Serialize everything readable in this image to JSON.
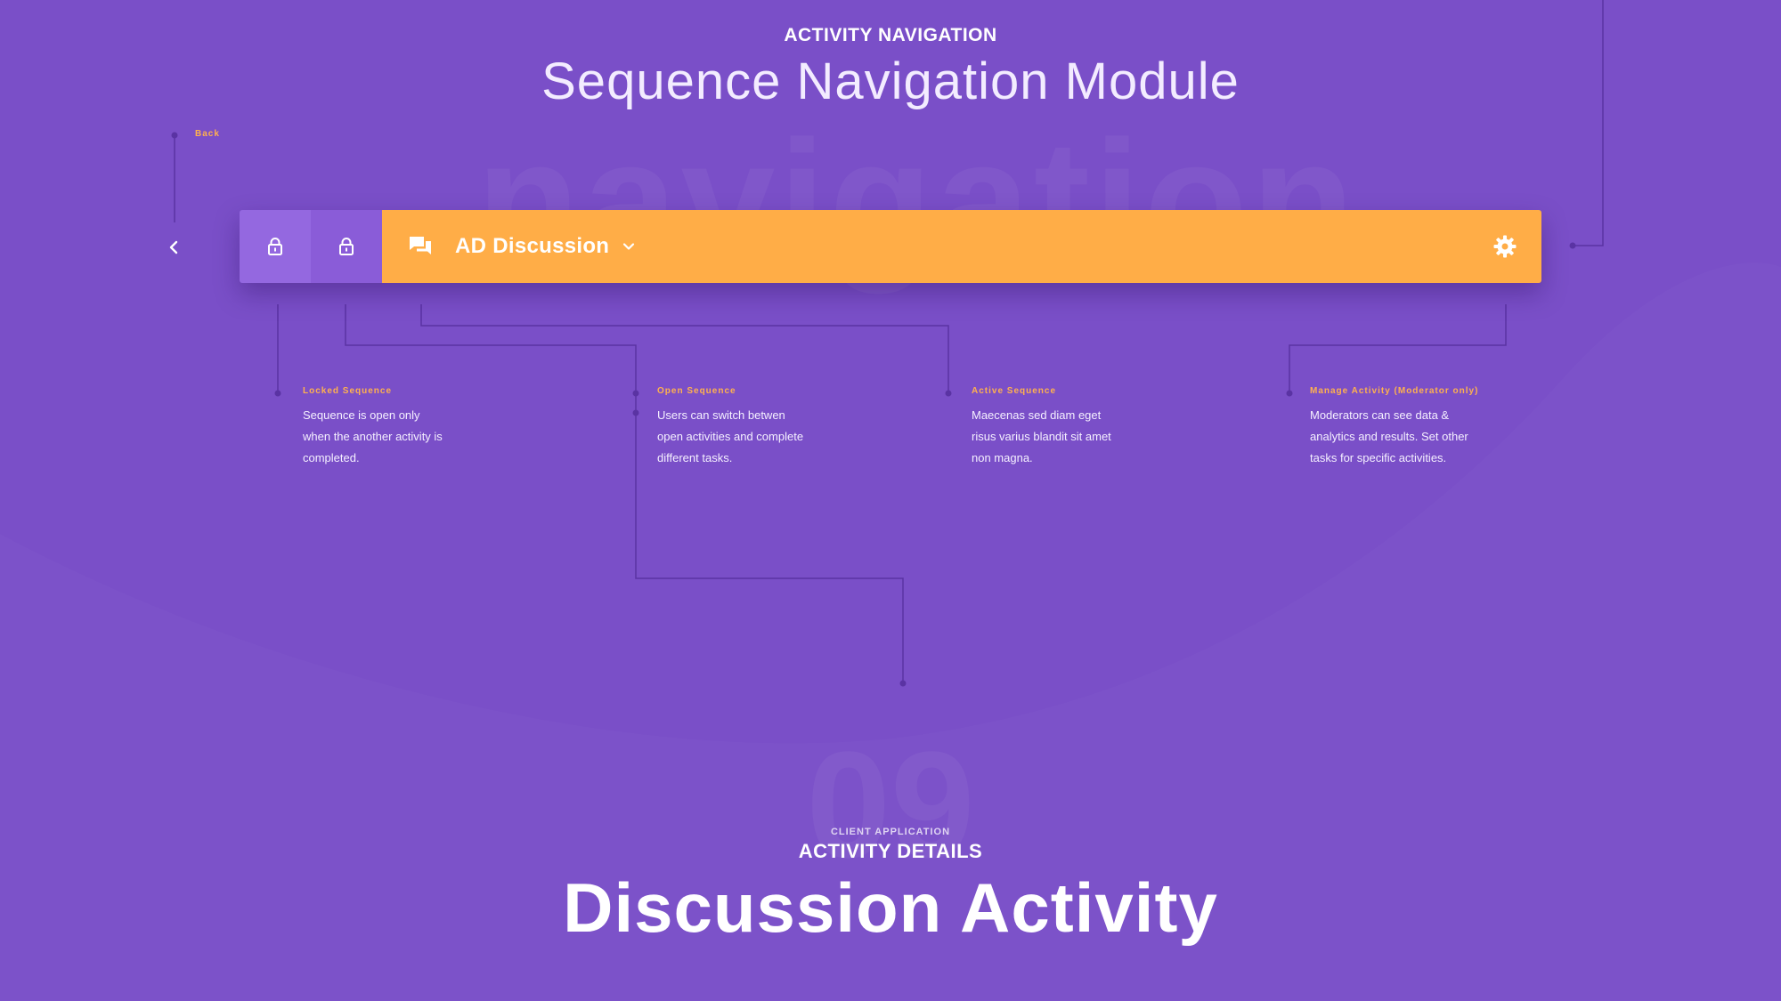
{
  "header": {
    "section_label": "ACTIVITY NAVIGATION",
    "title": "Sequence Navigation Module",
    "watermark": "navigation"
  },
  "nav": {
    "back_label": "Back",
    "active_title": "AD Discussion",
    "icons": {
      "back": "chevron-left-icon",
      "locked": "lock-icon",
      "open": "lock-icon",
      "chat": "chat-icon",
      "dropdown": "chevron-down-icon",
      "settings": "gear-icon"
    }
  },
  "annotations": [
    {
      "title": "Locked Sequence",
      "desc": [
        "Sequence is open only",
        "when the another activity is",
        "completed."
      ]
    },
    {
      "title": "Open Sequence",
      "desc": [
        "Users can switch betwen",
        "open activities and complete",
        "different tasks."
      ]
    },
    {
      "title": "Active Sequence",
      "desc": [
        "Maecenas sed diam eget",
        "risus varius blandit sit amet",
        "non magna."
      ]
    },
    {
      "title": "Manage Activity (Moderator only)",
      "desc": [
        "Moderators can see data &",
        "analytics and results. Set other",
        "tasks for specific activities."
      ]
    }
  ],
  "footer": {
    "watermark_number": "09",
    "eyebrow": "CLIENT APPLICATION",
    "subheading": "ACTIVITY DETAILS",
    "title": "Discussion Activity"
  },
  "colors": {
    "background": "#7a4fc8",
    "accent_orange": "#ffad47",
    "locked_cell": "#9468e0",
    "open_cell": "#8a5cd8",
    "connector": "#5a33a3"
  }
}
